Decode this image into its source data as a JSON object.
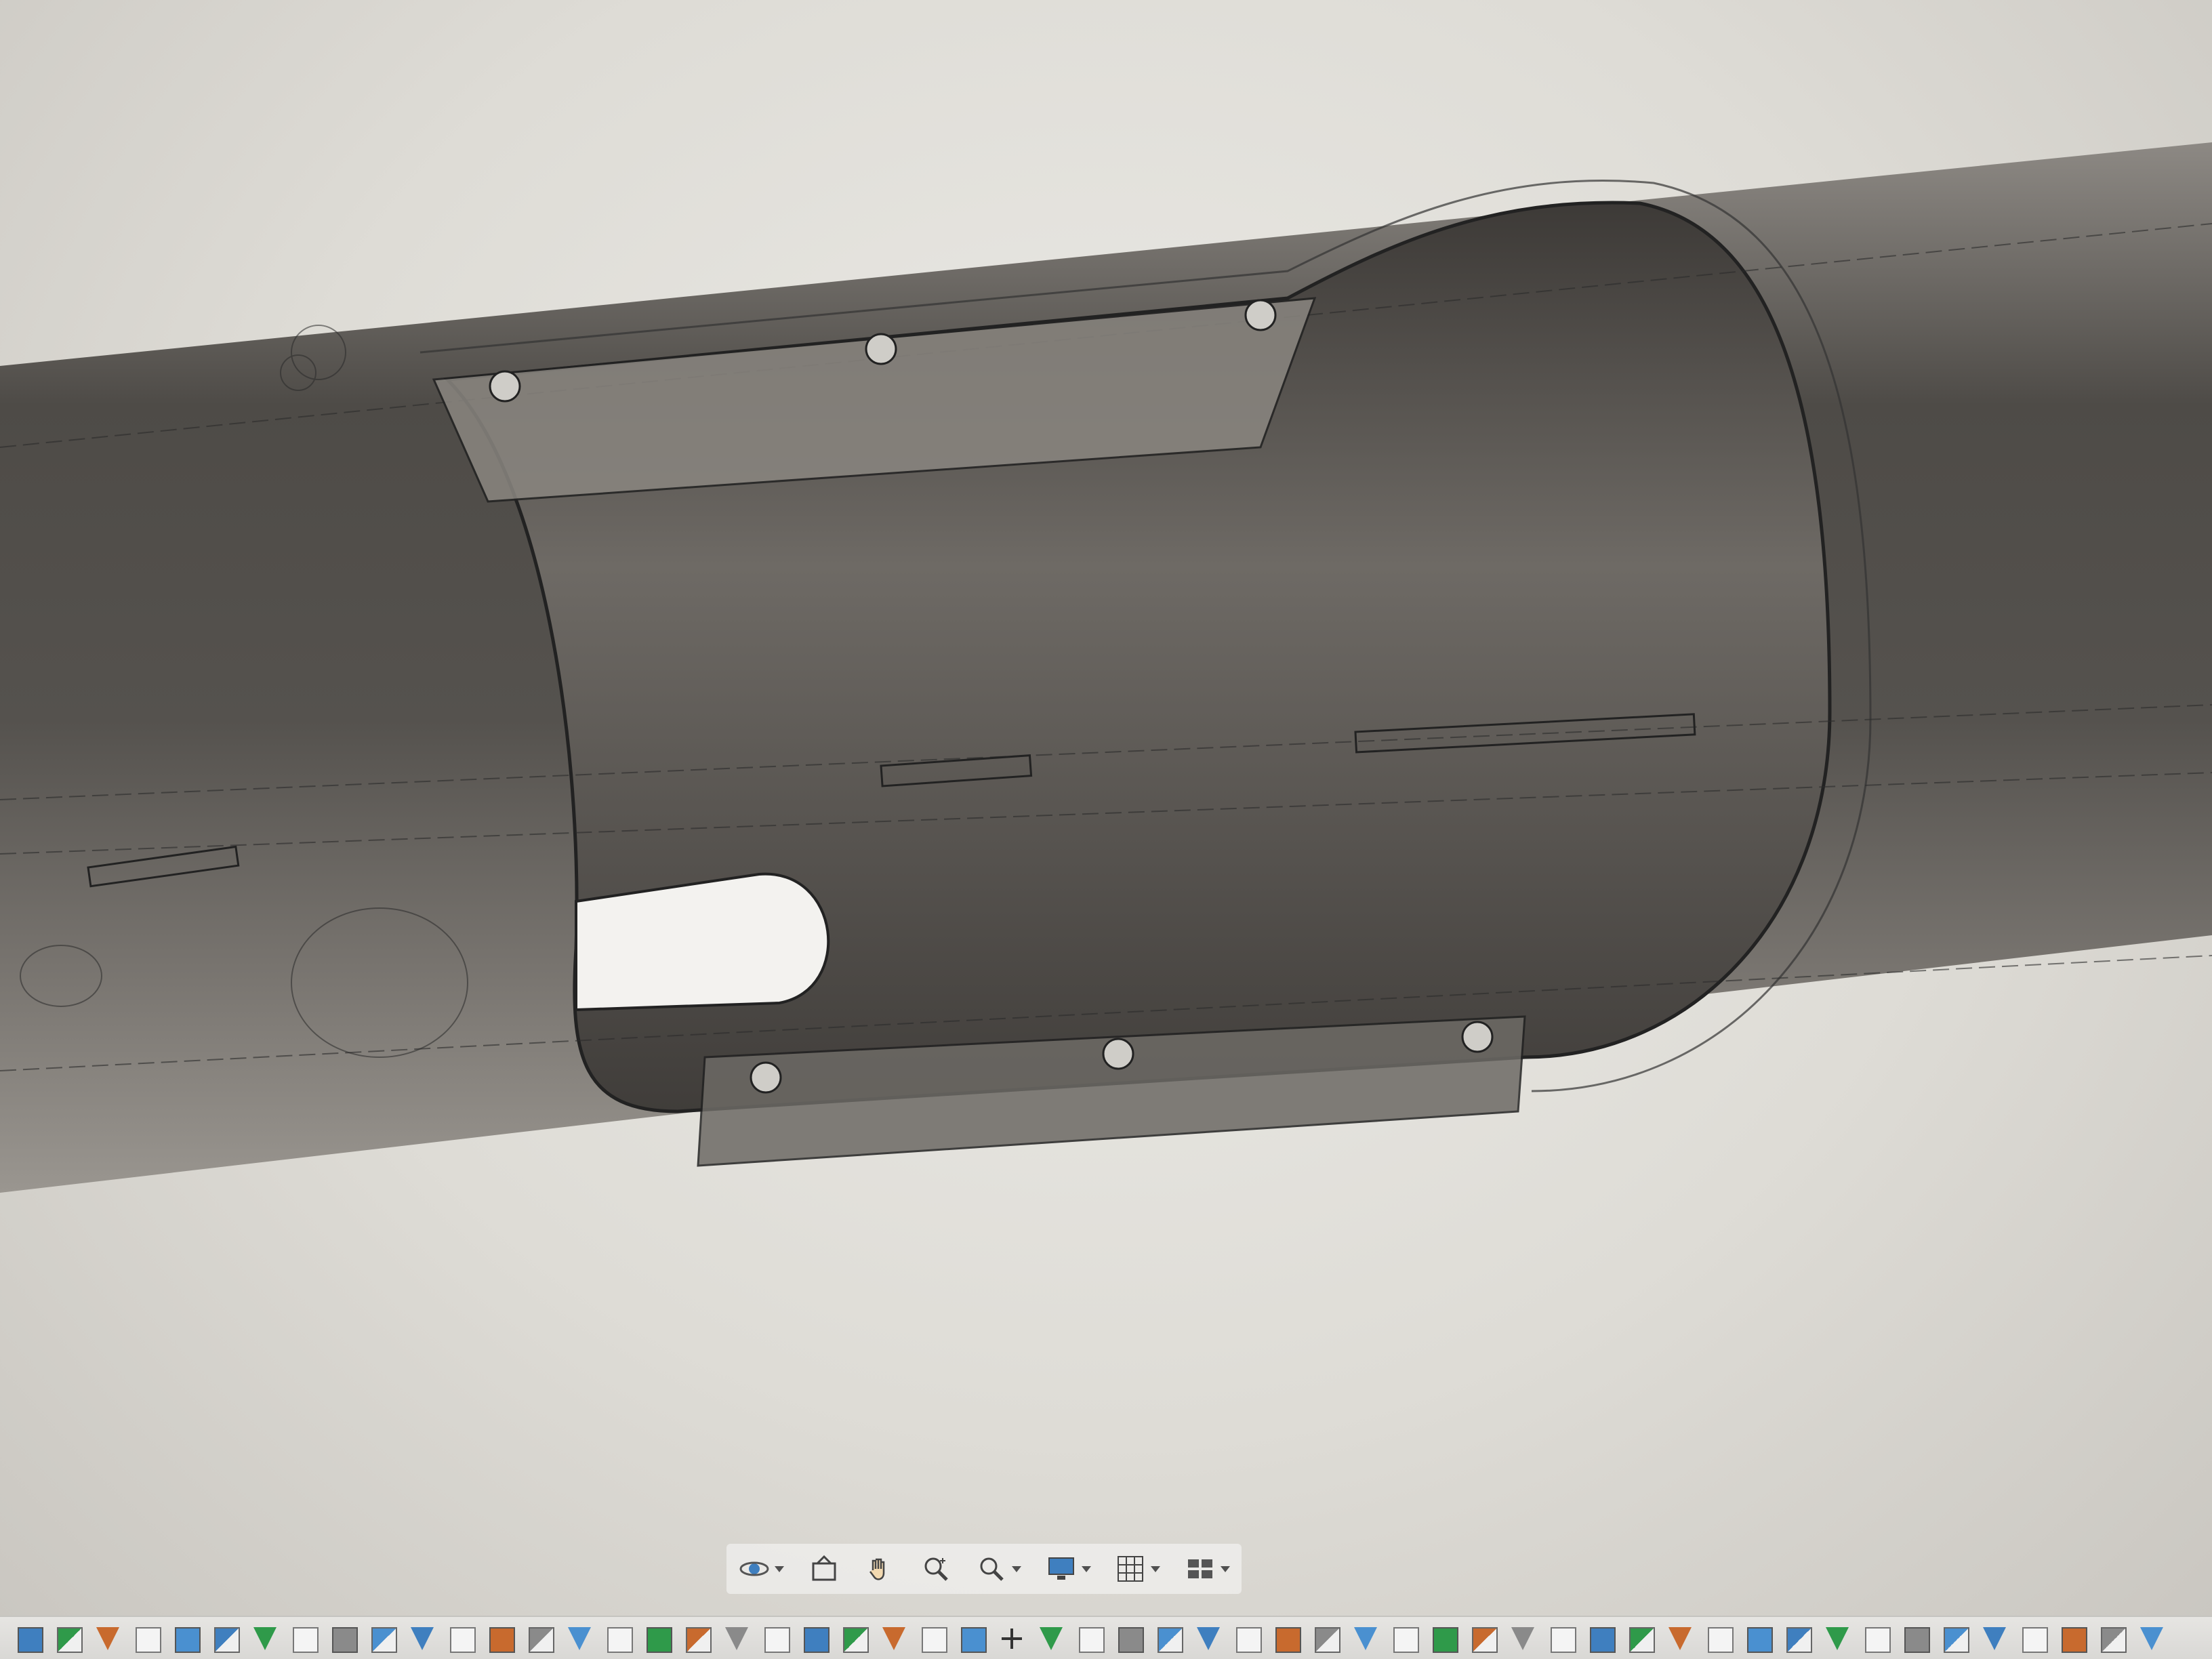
{
  "viewport": {
    "background_color": "#dedcd6",
    "model_body_color": "#5a5753",
    "edge_color": "#2a2a2a"
  },
  "nav_bar": {
    "buttons": [
      {
        "name": "orbit-icon",
        "dropdown": true
      },
      {
        "name": "look-at-icon",
        "dropdown": false
      },
      {
        "name": "pan-hand-icon",
        "dropdown": false
      },
      {
        "name": "zoom-icon",
        "dropdown": false
      },
      {
        "name": "zoom-window-icon",
        "dropdown": true
      },
      {
        "name": "display-settings-icon",
        "dropdown": true
      },
      {
        "name": "grid-icon",
        "dropdown": true
      },
      {
        "name": "viewports-icon",
        "dropdown": true
      }
    ]
  },
  "toolstrip": {
    "tools": [
      "tool-icon",
      "tool-icon",
      "tool-icon",
      "tool-icon",
      "tool-icon",
      "tool-icon",
      "tool-icon",
      "tool-icon",
      "tool-icon",
      "tool-icon",
      "tool-icon",
      "tool-icon",
      "tool-icon",
      "tool-icon",
      "tool-icon",
      "tool-icon",
      "tool-icon",
      "tool-icon",
      "tool-icon",
      "tool-icon",
      "tool-icon",
      "tool-icon",
      "tool-icon",
      "tool-icon",
      "tool-icon",
      "move-icon",
      "tool-icon",
      "tool-icon",
      "tool-icon",
      "tool-icon",
      "tool-icon",
      "tool-icon",
      "tool-icon",
      "tool-icon",
      "tool-icon",
      "tool-icon",
      "tool-icon",
      "tool-icon",
      "tool-icon",
      "tool-icon",
      "tool-icon",
      "tool-icon",
      "tool-icon",
      "tool-icon",
      "tool-icon",
      "tool-icon",
      "tool-icon",
      "tool-icon",
      "tool-icon",
      "tool-icon",
      "tool-icon",
      "tool-icon",
      "tool-icon",
      "tool-icon",
      "tool-icon"
    ],
    "colors": [
      "#3f7fbf",
      "#2f9a4a",
      "#c86a2e",
      "#8a8a8a",
      "#4a90d0"
    ]
  }
}
